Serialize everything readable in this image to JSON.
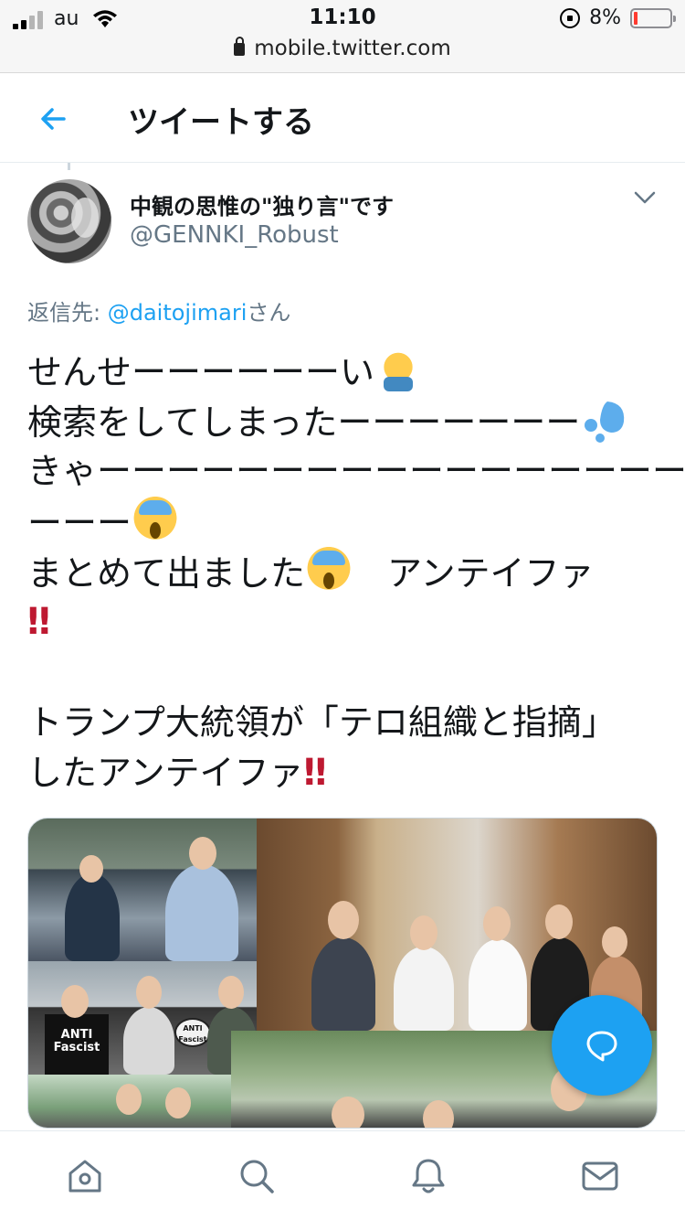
{
  "status_bar": {
    "carrier": "au",
    "time": "11:10",
    "url": "mobile.twitter.com",
    "battery": "8%"
  },
  "header": {
    "title": "ツイートする"
  },
  "tweet": {
    "author_name": "中観の思惟の\"独り言\"です",
    "author_handle": "@GENNKI_Robust",
    "reply_prefix": "返信先: ",
    "reply_mention": "@daitojimari",
    "reply_suffix": "さん",
    "lines": {
      "l1": "せんせーーーーーーい",
      "l2": "検索をしてしまったーーーーーーー",
      "l3": "きゃーーーーーーーーーーーーーーーーー",
      "l4": "ーーー",
      "l5a": "まとめて出ました",
      "l5b": "　アンテイファ",
      "l6": "",
      "l7": "",
      "l8": "トランプ大統領が「テロ組織と指摘」",
      "l9": "したアンテイファ"
    },
    "exclamation": "‼",
    "media": {
      "sign_text": "ANTI Fascist",
      "shirt_text": "ANTI Fascist"
    }
  },
  "icons": {
    "back": "back-arrow-icon",
    "more": "chevron-down-icon",
    "compose": "compose-reply-icon",
    "tabs": [
      "home-icon",
      "search-icon",
      "notifications-icon",
      "messages-icon"
    ]
  },
  "colors": {
    "accent": "#1da1f2",
    "secondary_text": "#657786",
    "exclamation": "#be1931"
  }
}
